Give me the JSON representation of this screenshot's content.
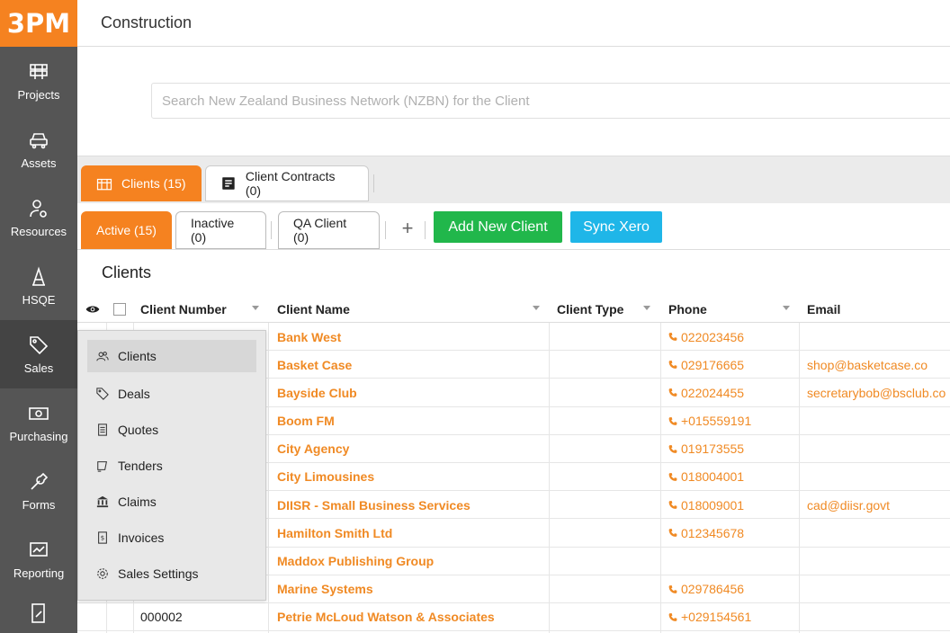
{
  "app": {
    "logo": "3PM",
    "title": "Construction"
  },
  "sidebar": {
    "items": [
      {
        "label": "Projects",
        "icon": "projects-icon"
      },
      {
        "label": "Assets",
        "icon": "car-icon"
      },
      {
        "label": "Resources",
        "icon": "person-gear-icon"
      },
      {
        "label": "HSQE",
        "icon": "hsqe-icon"
      },
      {
        "label": "Sales",
        "icon": "tag-icon"
      },
      {
        "label": "Purchasing",
        "icon": "money-icon"
      },
      {
        "label": "Forms",
        "icon": "wrench-icon"
      },
      {
        "label": "Reporting",
        "icon": "chart-icon"
      }
    ],
    "active": "Sales"
  },
  "search": {
    "placeholder": "Search New Zealand Business Network (NZBN) for the Client"
  },
  "tabs": {
    "clients": "Clients (15)",
    "contracts": "Client Contracts (0)"
  },
  "subtabs": {
    "active": "Active (15)",
    "inactive": "Inactive (0)",
    "qa": "QA Client (0)",
    "plus": "+",
    "add_button": "Add New Client",
    "sync_button": "Sync Xero"
  },
  "section_title": "Clients",
  "table": {
    "headers": [
      "Client Number",
      "Client Name",
      "Client Type",
      "Phone",
      "Email"
    ],
    "rows": [
      {
        "number": "",
        "name": "Bank West",
        "type": "",
        "phone": "022023456",
        "email": ""
      },
      {
        "number": "",
        "name": "Basket Case",
        "type": "",
        "phone": "029176665",
        "email": "shop@basketcase.co"
      },
      {
        "number": "",
        "name": "Bayside Club",
        "type": "",
        "phone": "022024455",
        "email": "secretarybob@bsclub.co"
      },
      {
        "number": "",
        "name": "Boom FM",
        "type": "",
        "phone": "+015559191",
        "email": ""
      },
      {
        "number": "",
        "name": "City Agency",
        "type": "",
        "phone": "019173555",
        "email": ""
      },
      {
        "number": "",
        "name": "City Limousines",
        "type": "",
        "phone": "018004001",
        "email": ""
      },
      {
        "number": "",
        "name": "DIISR - Small Business Services",
        "type": "",
        "phone": "018009001",
        "email": "cad@diisr.govt"
      },
      {
        "number": "",
        "name": "Hamilton Smith Ltd",
        "type": "",
        "phone": "012345678",
        "email": ""
      },
      {
        "number": "",
        "name": "Maddox Publishing Group",
        "type": "",
        "phone": "",
        "email": ""
      },
      {
        "number": "",
        "name": "Marine Systems",
        "type": "",
        "phone": "029786456",
        "email": ""
      },
      {
        "number": "000002",
        "name": "Petrie McLoud Watson & Associates",
        "type": "",
        "phone": "+029154561",
        "email": ""
      }
    ]
  },
  "sales_menu": {
    "items": [
      {
        "label": "Clients",
        "icon": "people-icon"
      },
      {
        "label": "Deals",
        "icon": "tag-icon"
      },
      {
        "label": "Quotes",
        "icon": "document-icon"
      },
      {
        "label": "Tenders",
        "icon": "tender-icon"
      },
      {
        "label": "Claims",
        "icon": "bank-icon"
      },
      {
        "label": "Invoices",
        "icon": "invoice-icon"
      },
      {
        "label": "Sales Settings",
        "icon": "gear-icon"
      }
    ],
    "active": "Clients"
  },
  "colors": {
    "brand": "#f58220",
    "sidebar": "#555555",
    "green": "#21b74b",
    "blue": "#1fb6e8",
    "link": "#f08a24"
  }
}
